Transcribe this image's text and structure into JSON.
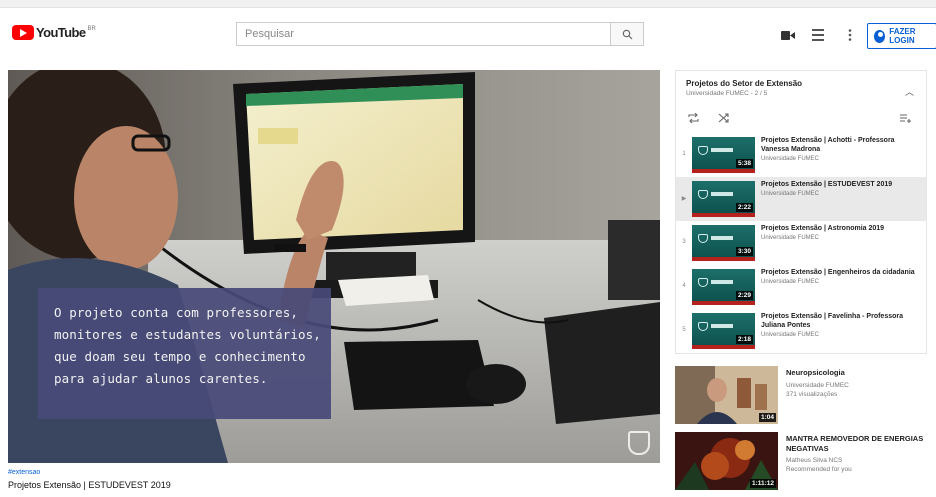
{
  "header": {
    "logo_text": "YouTube",
    "logo_region": "BR",
    "search_placeholder": "Pesquisar",
    "signin_label": "FAZER LOGIN"
  },
  "video": {
    "caption_lines": [
      "O projeto conta com professores,",
      "monitores e estudantes voluntários,",
      "que doam seu tempo e conhecimento",
      "para ajudar alunos carentes."
    ],
    "hashtags": "#extensao",
    "title": "Projetos Extensão | ESTUDEVEST 2019"
  },
  "playlist": {
    "title": "Projetos do Setor de Extensão",
    "subtitle": "Universidade FUMEC - 2 / 5",
    "items": [
      {
        "index": "1",
        "title": "Projetos Extensão | Achotti - Professora Vanessa Madrona",
        "channel": "Universidade FUMEC",
        "duration": "5:38",
        "active": false
      },
      {
        "index": "▶",
        "title": "Projetos Extensão | ESTUDEVEST 2019",
        "channel": "Universidade FUMEC",
        "duration": "2:22",
        "active": true
      },
      {
        "index": "3",
        "title": "Projetos Extensão | Astronomia 2019",
        "channel": "Universidade FUMEC",
        "duration": "3:30",
        "active": false
      },
      {
        "index": "4",
        "title": "Projetos Extensão | Engenheiros da cidadania",
        "channel": "Universidade FUMEC",
        "duration": "2:29",
        "active": false
      },
      {
        "index": "5",
        "title": "Projetos Extensão | Favelinha - Professora Juliana Pontes",
        "channel": "Universidade FUMEC",
        "duration": "2:18",
        "active": false
      }
    ]
  },
  "recommendations": [
    {
      "title": "Neuropsicologia",
      "channel": "Universidade FUMEC",
      "meta": "371 visualizações",
      "duration": "1:04"
    },
    {
      "title": "MANTRA REMOVEDOR DE ENERGIAS NEGATIVAS",
      "channel": "Matheus Silva NCS",
      "meta": "Recommended for you",
      "duration": "1:11:12"
    }
  ],
  "colors": {
    "brand_red": "#ff0000",
    "link_blue": "#065fd4",
    "caption_bg": "#484a78",
    "thumb_teal": "#1d6f6a"
  }
}
